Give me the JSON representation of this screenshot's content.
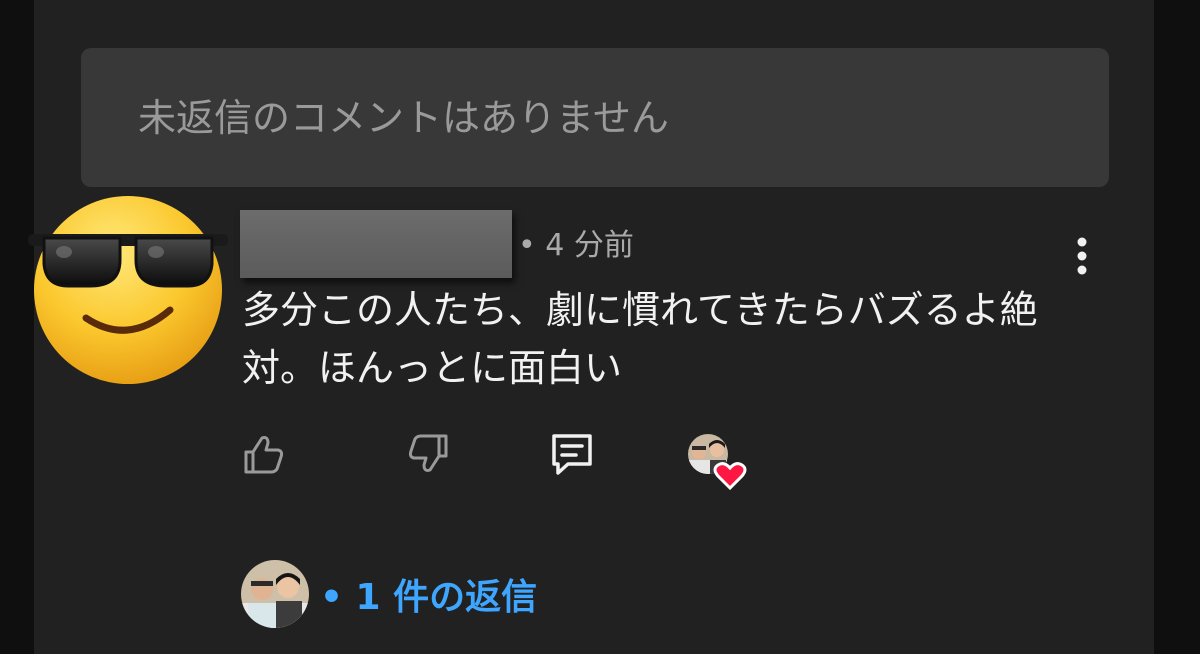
{
  "filter_message": "未返信のコメントはありません",
  "comment": {
    "time_label": "• 4 分前",
    "text": "多分この人たち、劇に慣れてきたらバズるよ絶対。ほんっとに面白い",
    "author_avatar_icon": "sunglasses-emoji-icon",
    "actions": {
      "like_icon": "thumbs-up-icon",
      "dislike_icon": "thumbs-down-icon",
      "reply_icon": "reply-icon",
      "more_icon": "more-vertical-icon"
    },
    "creator_heart_icon": "heart-icon",
    "replies_label": "• 1 件の返信"
  },
  "colors": {
    "background": "#212121",
    "filter_box": "#383838",
    "link": "#3ea6ff",
    "heart": "#ff1744"
  }
}
